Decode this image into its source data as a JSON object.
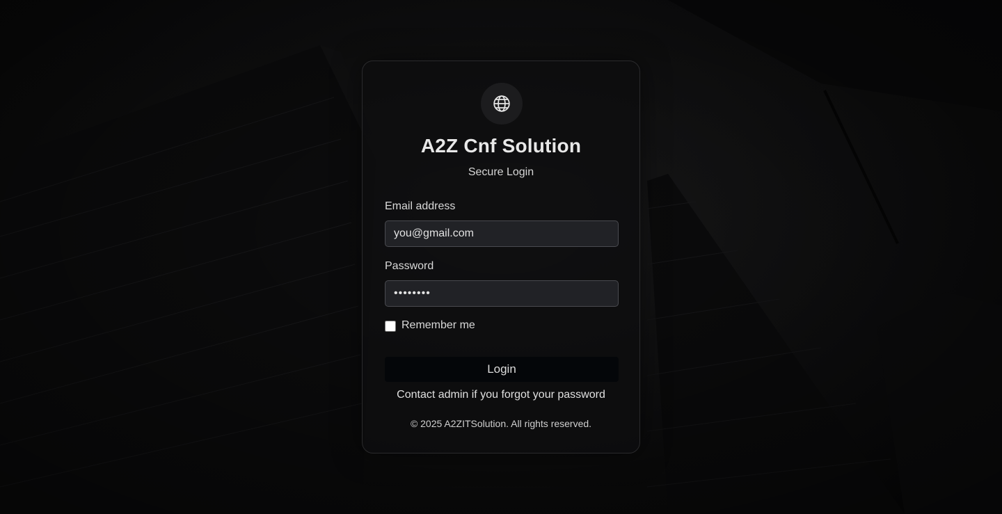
{
  "app": {
    "title": "A2Z Cnf Solution",
    "subtitle": "Secure Login",
    "logo_icon": "globe-icon"
  },
  "form": {
    "email_label": "Email address",
    "email_value": "you@gmail.com",
    "password_label": "Password",
    "password_value": "••••••••",
    "remember_label": "Remember me",
    "remember_checked": false,
    "login_label": "Login",
    "forgot_text": "Contact admin if you forgot your password"
  },
  "footer": {
    "copyright": "© 2025 A2ZITSolution. All rights reserved."
  },
  "colors": {
    "background": "#0b0b0c",
    "card": "#0e0e0f",
    "input_bg": "#212226",
    "button_bg": "#040609",
    "text": "#e8e8e8"
  }
}
